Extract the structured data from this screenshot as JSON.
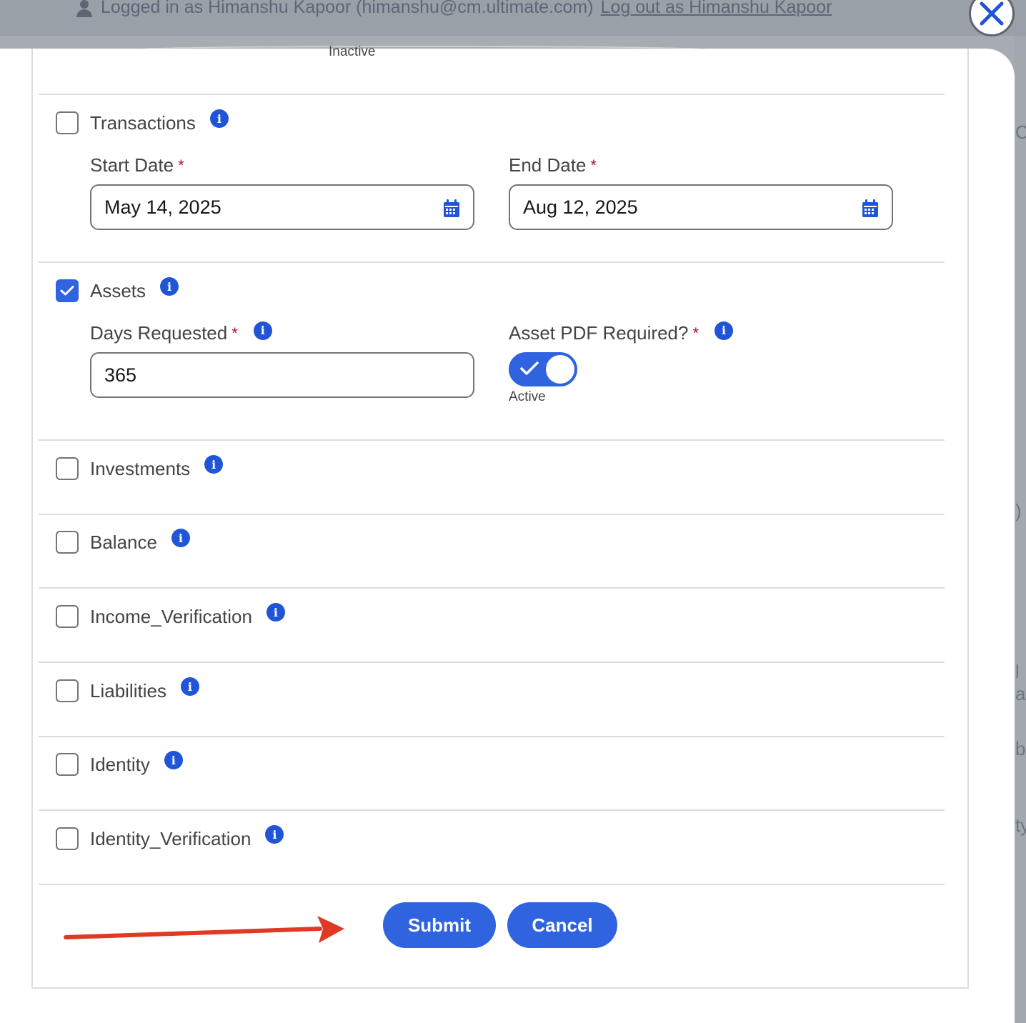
{
  "background": {
    "login_text": "Logged in as Himanshu Kapoor (himanshu@cm.ultimate.com)",
    "logout_text": "Log out as Himanshu Kapoor",
    "right_fragments": [
      "C",
      ")",
      "l a",
      "b",
      "ty"
    ]
  },
  "modal": {
    "top_remnant": "Inactive",
    "sections": {
      "transactions": {
        "label": "Transactions",
        "checked": false,
        "start_date_label": "Start Date",
        "start_date_value": "May 14, 2025",
        "end_date_label": "End Date",
        "end_date_value": "Aug 12, 2025"
      },
      "assets": {
        "label": "Assets",
        "checked": true,
        "days_label": "Days Requested",
        "days_value": "365",
        "pdf_label": "Asset PDF Required?",
        "pdf_state_text": "Active"
      },
      "investments": {
        "label": "Investments",
        "checked": false
      },
      "balance": {
        "label": "Balance",
        "checked": false
      },
      "income_verification": {
        "label": "Income_Verification",
        "checked": false
      },
      "liabilities": {
        "label": "Liabilities",
        "checked": false
      },
      "identity": {
        "label": "Identity",
        "checked": false
      },
      "identity_verification": {
        "label": "Identity_Verification",
        "checked": false
      }
    },
    "required_marker": "*",
    "buttons": {
      "submit": "Submit",
      "cancel": "Cancel"
    }
  },
  "colors": {
    "primary": "#2f63e0",
    "info": "#1f55d6",
    "required": "#b0123b",
    "annotation_arrow": "#e03a24"
  },
  "icons": [
    "user-icon",
    "close-icon",
    "info-icon",
    "calendar-icon",
    "checkmark-icon",
    "arrow-annotation"
  ]
}
